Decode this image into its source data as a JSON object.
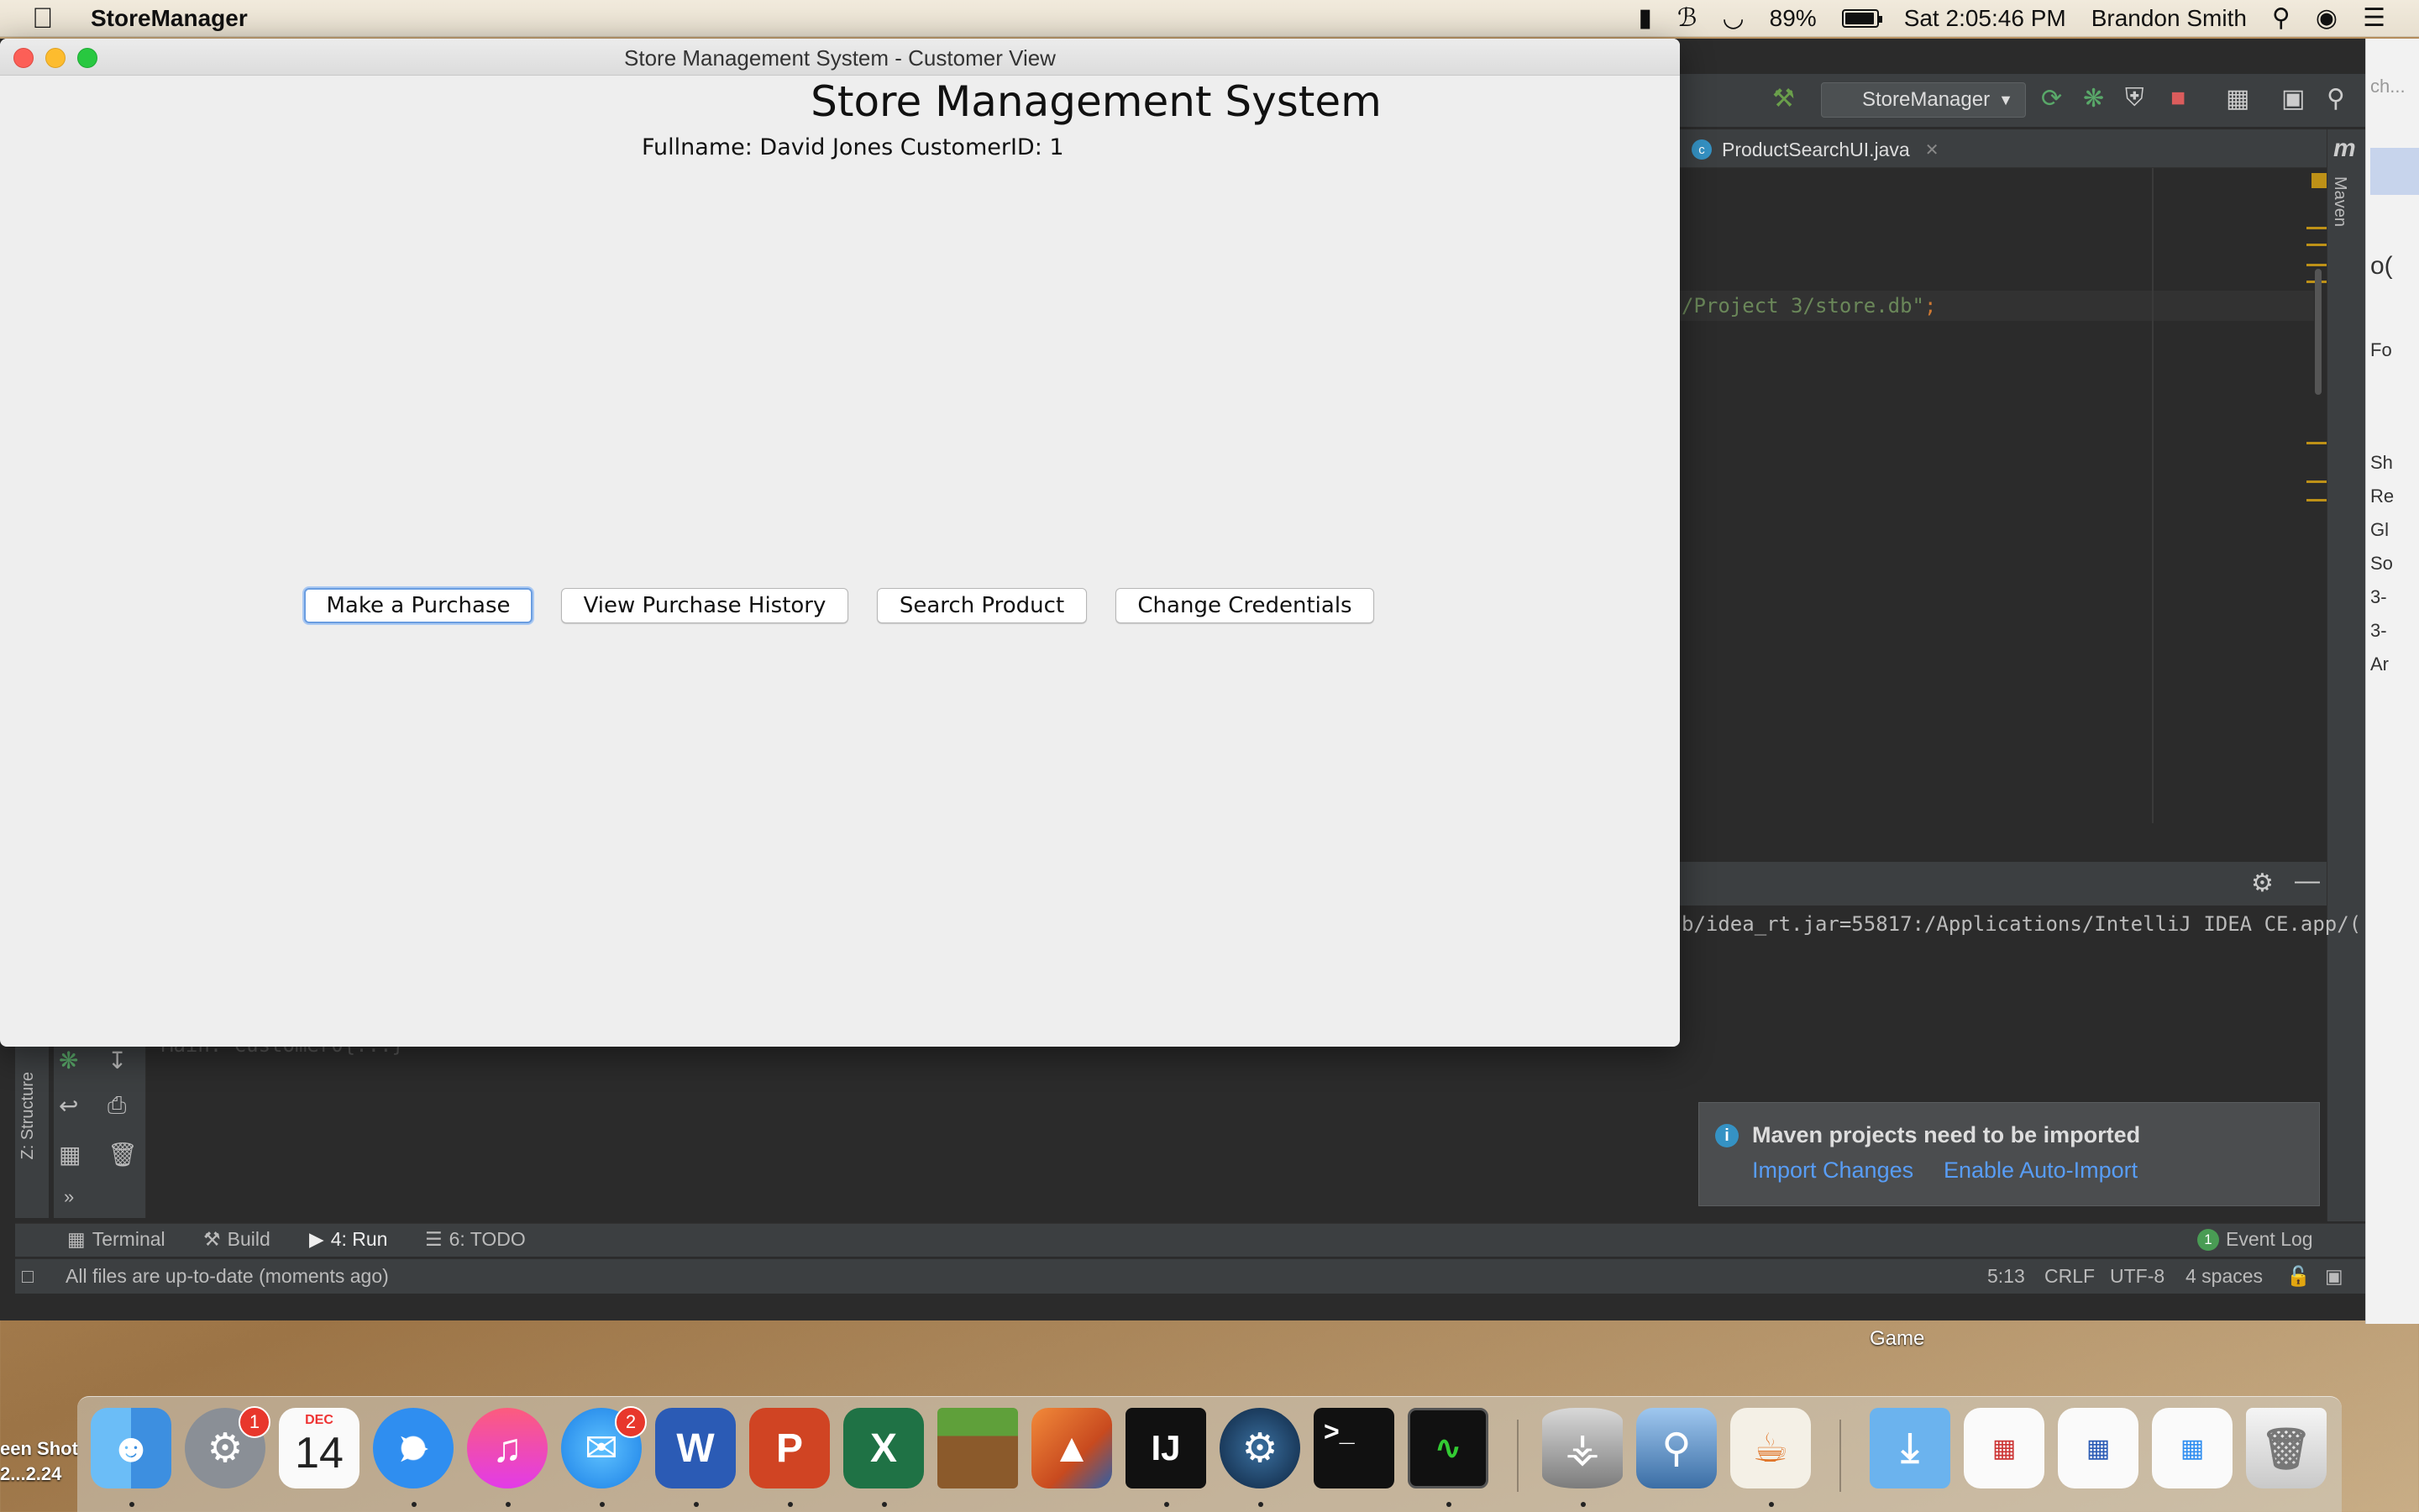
{
  "menubar": {
    "app_name": "StoreManager",
    "battery": "89%",
    "clock": "Sat 2:05:46 PM",
    "user": "Brandon Smith",
    "icons": [
      "apple-icon",
      "tray-icon",
      "bluetooth-icon",
      "wifi-icon",
      "battery-icon",
      "spotlight-icon",
      "siri-icon",
      "notification-center-icon"
    ]
  },
  "ide": {
    "run_config": "StoreManager",
    "open_tab": "ProductSearchUI.java",
    "code_line": "/Project 3/store.db\"",
    "code_semicolon": ";",
    "maven_label": "Maven",
    "console_line": "b/idea_rt.jar=55817:/Applications/IntelliJ IDEA CE.app/(",
    "console_ghost": "Main: Customer0{...}",
    "structure_label": "Z: Structure",
    "notification": {
      "title": "Maven projects need to be imported",
      "import_changes": "Import Changes",
      "enable_auto_import": "Enable Auto-Import"
    },
    "tool_tabs": {
      "terminal": "Terminal",
      "build": "Build",
      "run": "4: Run",
      "todo": "6: TODO",
      "event_log": "Event Log",
      "event_log_count": "1"
    },
    "status": {
      "message": "All files are up-to-date (moments ago)",
      "position": "5:13",
      "line_sep": "CRLF",
      "encoding": "UTF-8",
      "indent": "4 spaces"
    },
    "right_app_fragments": [
      "ch...",
      "o(",
      "Fo",
      "Sh",
      "Re",
      "Gl",
      "So",
      "3-",
      "3-",
      "Ar"
    ]
  },
  "window": {
    "title": "Store Management System - Customer View",
    "heading": "Store Management System",
    "customer_info": "Fullname: David Jones  CustomerID: 1",
    "buttons": {
      "purchase": "Make a Purchase",
      "history": "View Purchase History",
      "search": "Search Product",
      "credentials": "Change Credentials"
    }
  },
  "desktop": {
    "game_label": "Game",
    "screenshot_label_1": "een Shot",
    "screenshot_label_2": "2...2.24"
  },
  "dock": {
    "calendar_month": "DEC",
    "calendar_day": "14",
    "prefs_badge": "1",
    "messages_badge": "2",
    "word_letter": "W",
    "powerpoint_letter": "P",
    "excel_letter": "X",
    "intellij_letter": "IJ",
    "terminal_prompt": ">_"
  }
}
